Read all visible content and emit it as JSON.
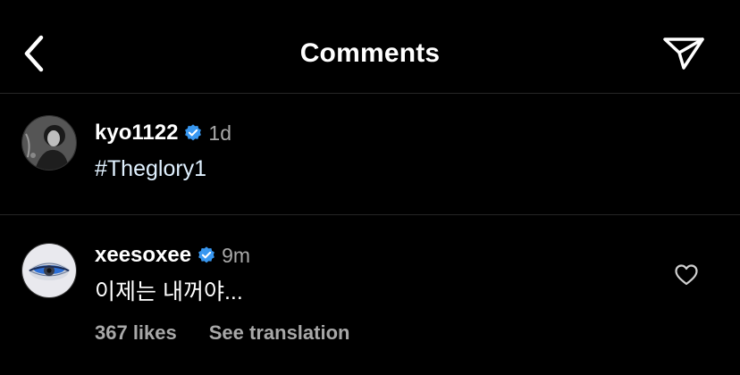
{
  "header": {
    "title": "Comments",
    "back_icon": "chevron-left-icon",
    "share_icon": "paper-plane-icon"
  },
  "caption": {
    "username": "kyo1122",
    "verified": true,
    "timestamp": "1d",
    "text": "#Theglory1"
  },
  "comment": {
    "username": "xeesoxee",
    "verified": true,
    "timestamp": "9m",
    "text": "이제는 내꺼야...",
    "likes": "367 likes",
    "see_translation": "See translation",
    "like_icon": "heart-outline-icon"
  },
  "colors": {
    "background": "#000000",
    "text": "#ffffff",
    "secondary_text": "#a8a8a8",
    "divider": "#262626",
    "verified_badge": "#3897f0"
  }
}
